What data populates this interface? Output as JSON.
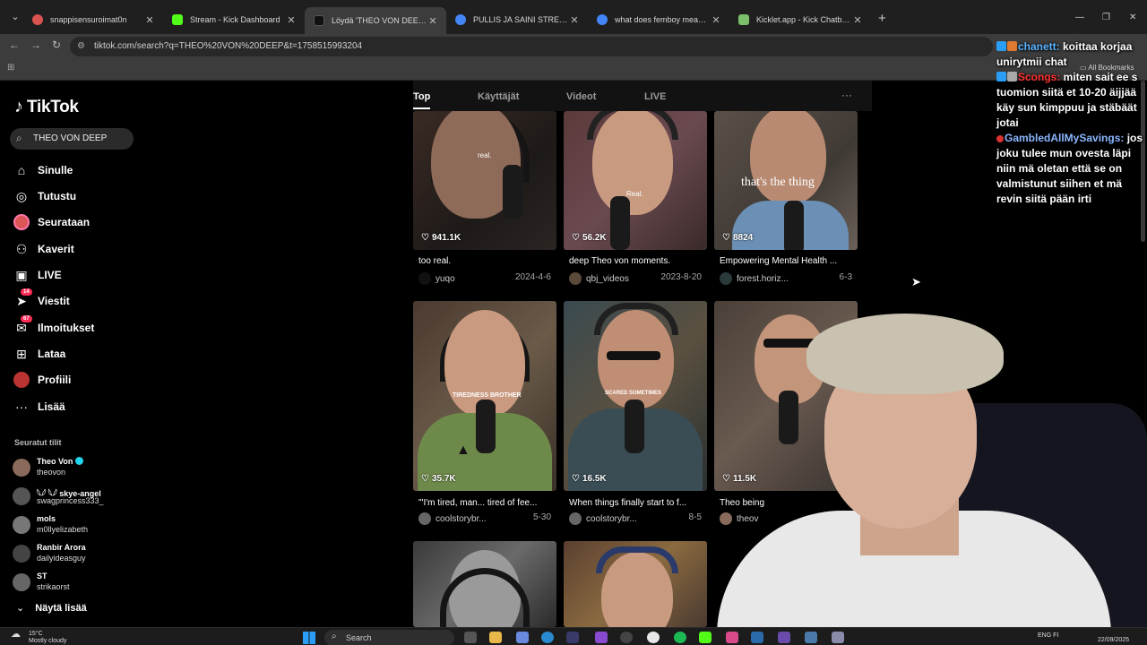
{
  "browser": {
    "tabs": [
      {
        "title": "snappisensuroimat0n",
        "active": false,
        "color": "#d9534f"
      },
      {
        "title": "Stream - Kick Dashboard",
        "active": false,
        "color": "#53fc18"
      },
      {
        "title": "Löydä 'THEO VON DEEP' TikTok",
        "active": true,
        "color": "#000000"
      },
      {
        "title": "PULLIS JA SAINI STREAM - Goo",
        "active": false,
        "color": "#4285f4"
      },
      {
        "title": "what does femboy mean - Goo",
        "active": false,
        "color": "#4285f4"
      },
      {
        "title": "Kicklet.app - Kick Chatbot and",
        "active": false,
        "color": "#7bbf6a"
      }
    ],
    "url": "tiktok.com/search?q=THEO%20VON%20DEEP&t=1758515993204",
    "all_bookmarks": "All Bookmarks"
  },
  "sidebar": {
    "brand": "TikTok",
    "search_query": "THEO VON DEEP",
    "nav": [
      {
        "label": "Sinulle",
        "icon": "home-icon",
        "glyph": "⌂"
      },
      {
        "label": "Tutustu",
        "icon": "compass-icon",
        "glyph": "◎"
      },
      {
        "label": "Seurataan",
        "icon": "following-avatar-icon",
        "glyph": ""
      },
      {
        "label": "Kaverit",
        "icon": "friends-icon",
        "glyph": "👥"
      },
      {
        "label": "LIVE",
        "icon": "live-icon",
        "glyph": "▣"
      },
      {
        "label": "Viestit",
        "icon": "messages-icon",
        "glyph": "✈",
        "badge": "14"
      },
      {
        "label": "Ilmoitukset",
        "icon": "notifications-icon",
        "glyph": "✉",
        "badge": "67"
      },
      {
        "label": "Lataa",
        "icon": "upload-icon",
        "glyph": "⊞"
      },
      {
        "label": "Profiili",
        "icon": "profile-avatar-icon",
        "glyph": ""
      },
      {
        "label": "Lisää",
        "icon": "more-icon",
        "glyph": "···"
      }
    ],
    "following_title": "Seuratut tilit",
    "following": [
      {
        "name": "Theo Von",
        "handle": "theovon",
        "verified": true
      },
      {
        "name": "𓆩𓆪 𓆩𓆪 skye-angel",
        "handle": "swagprincess333_",
        "verified": false
      },
      {
        "name": "mols",
        "handle": "m0llyelizabeth",
        "verified": false
      },
      {
        "name": "Ranbir Arora",
        "handle": "dailyideasguy",
        "verified": false
      },
      {
        "name": "ST",
        "handle": "strikaorst",
        "verified": false
      }
    ],
    "see_more": "Näytä lisää"
  },
  "results_tabs": [
    "Top",
    "Käyttäjät",
    "Videot",
    "LIVE"
  ],
  "videos": [
    {
      "likes": "941.1K",
      "title": "too real.",
      "author": "yuqo",
      "date": "2024-4-6",
      "overlay": "real."
    },
    {
      "likes": "56.2K",
      "title": "deep Theo von moments.",
      "author": "qbj_videos",
      "date": "2023-8-20",
      "overlay": "Real."
    },
    {
      "likes": "8824",
      "title": "Empowering Mental Health ...",
      "author": "forest.horiz...",
      "date": "6-3",
      "overlay": "that's the thing"
    },
    {
      "likes": "35.7K",
      "title": "\"'I'm tired, man... tired of fee...",
      "author": "coolstorybr...",
      "date": "5-30",
      "overlay": "TIREDNESS BROTHER"
    },
    {
      "likes": "16.5K",
      "title": "When things finally start to f...",
      "author": "coolstorybr...",
      "date": "8-5",
      "overlay": "SCARED SOMETIMES"
    },
    {
      "likes": "11.5K",
      "title": "Theo being",
      "author": "theov",
      "date": "",
      "overlay": ""
    }
  ],
  "chat": [
    {
      "user": "chanett:",
      "msg": " koittaa korjaa unirytmii chat",
      "color": "#5ab4ff"
    },
    {
      "user": "Scongs:",
      "msg": " miten sait ee s tuomion siitä et 10-20 äijjää käy sun kimppuu ja stäbäät jotai",
      "color": "#ff3030"
    },
    {
      "user": "GambledAllMySavings:",
      "msg": " jos joku tulee mun ovesta läpi niin mä oletan että se on valmistunut siihen et mä revin siitä pään irti",
      "color": "#8ab7ff"
    }
  ],
  "taskbar": {
    "temp": "15°C",
    "weather": "Mostly cloudy",
    "search": "Search",
    "lang": "ENG",
    "region": "FI",
    "time": "",
    "date": "22/09/2025"
  }
}
